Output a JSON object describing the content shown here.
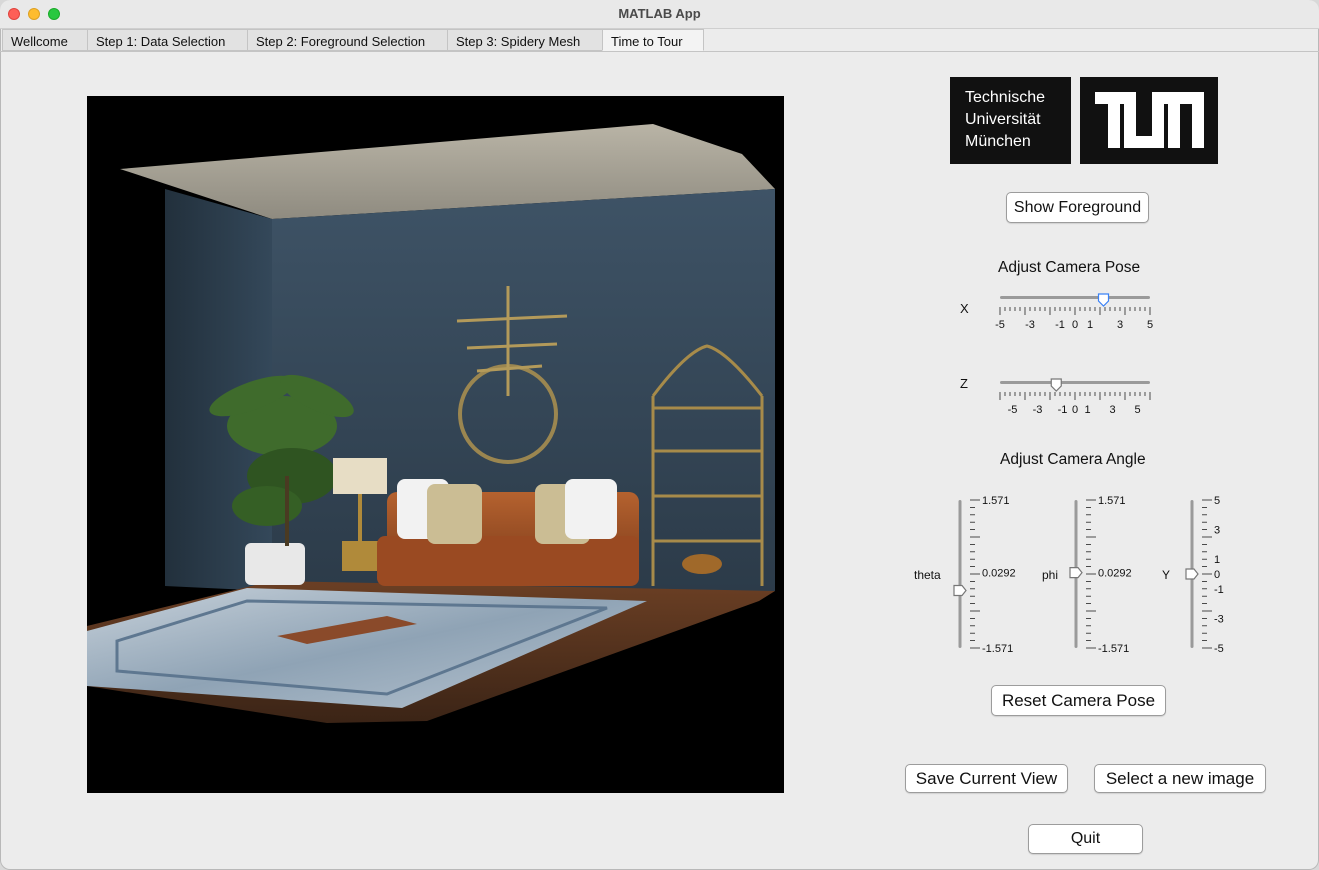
{
  "window": {
    "title": "MATLAB App"
  },
  "tabs": [
    {
      "label": "Wellcome",
      "active": false
    },
    {
      "label": "Step 1: Data Selection",
      "active": false
    },
    {
      "label": "Step 2: Foreground Selection",
      "active": false
    },
    {
      "label": "Step 3: Spidery Mesh",
      "active": false
    },
    {
      "label": "Time to Tour",
      "active": true
    }
  ],
  "logo": {
    "lines": [
      "Technische",
      "Universität",
      "München"
    ],
    "mark": "TUM"
  },
  "buttons": {
    "show_foreground": "Show Foreground",
    "reset_pose": "Reset Camera Pose",
    "save_view": "Save Current View",
    "select_image": "Select a new image",
    "quit": "Quit"
  },
  "pose": {
    "heading": "Adjust Camera Pose",
    "x": {
      "label": "X",
      "min": -5,
      "max": 5,
      "value": 1.9,
      "ticks": [
        "-5",
        "-3",
        "-1",
        "0",
        "1",
        "3",
        "5"
      ]
    },
    "z": {
      "label": "Z",
      "min": -6,
      "max": 6,
      "value": -1.5,
      "ticks": [
        "-5",
        "-3",
        "-1",
        "0",
        "1",
        "3",
        "5"
      ]
    }
  },
  "angle": {
    "heading": "Adjust Camera Angle",
    "theta": {
      "label": "theta",
      "min": -1.571,
      "max": 1.571,
      "value": -0.35,
      "ticks": [
        "1.571",
        "0.0292",
        "-1.571"
      ]
    },
    "phi": {
      "label": "phi",
      "min": -1.571,
      "max": 1.571,
      "value": 0.0292,
      "ticks": [
        "1.571",
        "0.0292",
        "-1.571"
      ]
    },
    "y": {
      "label": "Y",
      "min": -5,
      "max": 5,
      "value": 0,
      "ticks": [
        "5",
        "3",
        "1",
        "0",
        "-1",
        "-3",
        "-5"
      ]
    }
  },
  "colors": {
    "accent": "#3b82f6",
    "wall": "#35485a",
    "sofa": "#a5522a",
    "rug": "#a9b7c6"
  },
  "scene": {
    "description_icons": [
      "room-render"
    ]
  }
}
